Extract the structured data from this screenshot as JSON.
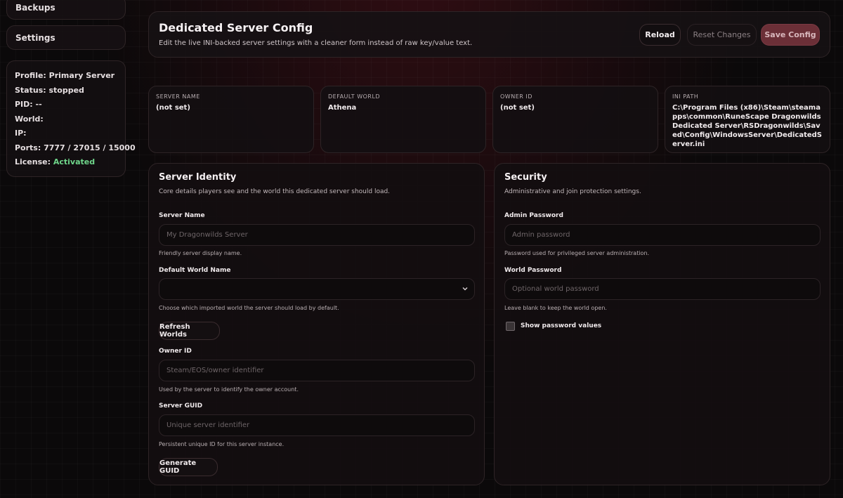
{
  "sidebar": {
    "nav": [
      {
        "label": "Backups"
      },
      {
        "label": "Settings"
      }
    ],
    "status": {
      "profile_label": "Profile:",
      "profile_value": "Primary Server",
      "status_label": "Status:",
      "status_value": "stopped",
      "pid_label": "PID:",
      "pid_value": "--",
      "world_label": "World:",
      "world_value": "",
      "ip_label": "IP:",
      "ip_value": "",
      "ports_label": "Ports:",
      "ports_value": "7777 / 27015 / 15000",
      "license_label": "License:",
      "license_value": "Activated",
      "license_color": "#6fd58a"
    }
  },
  "header": {
    "title": "Dedicated Server Config",
    "subtitle": "Edit the live INI-backed server settings with a cleaner form instead of raw key/value text.",
    "reload_label": "Reload",
    "reset_label": "Reset Changes",
    "save_label": "Save Config"
  },
  "info_cards": [
    {
      "key": "SERVER NAME",
      "value": "(not set)"
    },
    {
      "key": "DEFAULT WORLD",
      "value": "Athena"
    },
    {
      "key": "OWNER ID",
      "value": "(not set)"
    },
    {
      "key": "INI PATH",
      "value": "C:\\Program Files (x86)\\Steam\\steamapps\\common\\RuneScape Dragonwilds Dedicated Server\\RSDragonwilds\\Saved\\Config\\WindowsServer\\DedicatedServer.ini"
    }
  ],
  "identity": {
    "title": "Server Identity",
    "subtitle": "Core details players see and the world this dedicated server should load.",
    "server_name_label": "Server Name",
    "server_name_placeholder": "My Dragonwilds Server",
    "server_name_hint": "Friendly server display name.",
    "world_label": "Default World Name",
    "world_value": "",
    "world_hint": "Choose which imported world the server should load by default.",
    "refresh_label": "Refresh Worlds",
    "owner_label": "Owner ID",
    "owner_placeholder": "Steam/EOS/owner identifier",
    "owner_hint": "Used by the server to identify the owner account.",
    "guid_label": "Server GUID",
    "guid_placeholder": "Unique server identifier",
    "guid_hint": "Persistent unique ID for this server instance.",
    "generate_label": "Generate GUID"
  },
  "security": {
    "title": "Security",
    "subtitle": "Administrative and join protection settings.",
    "admin_label": "Admin Password",
    "admin_placeholder": "Admin password",
    "admin_hint": "Password used for privileged server administration.",
    "world_pw_label": "World Password",
    "world_pw_placeholder": "Optional world password",
    "world_pw_hint": "Leave blank to keep the world open.",
    "show_pw_label": "Show password values",
    "show_pw_checked": false
  },
  "colors": {
    "accent": "#6b2f37",
    "background": "#0b090a",
    "success": "#6fd58a"
  }
}
